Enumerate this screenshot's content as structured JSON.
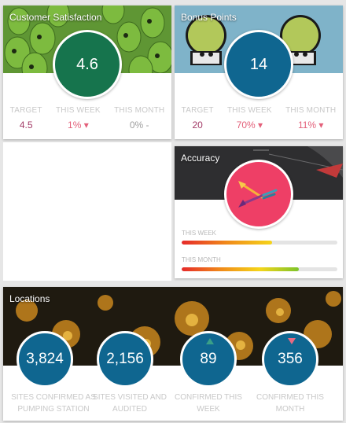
{
  "satisfaction": {
    "title": "Customer Satisfaction",
    "score": "4.6",
    "target_label": "TARGET",
    "target_value": "4.5",
    "week_label": "THIS WEEK",
    "week_value": "1% ▾",
    "month_label": "THIS MONTH",
    "month_value": "0% -",
    "circle_color": "#16744d"
  },
  "bonus": {
    "title": "Bonus Points",
    "score": "14",
    "target_label": "TARGET",
    "target_value": "20",
    "week_label": "THIS WEEK",
    "week_value": "70% ▾",
    "month_label": "THIS MONTH",
    "month_value": "11% ▾",
    "circle_color": "#0f6690"
  },
  "accuracy": {
    "title": "Accuracy",
    "week_label": "THIS WEEK",
    "week_level": 0.58,
    "month_label": "THIS MONTH",
    "month_level": 0.75,
    "circle_color": "#ee3f66"
  },
  "locations": {
    "title": "Locations",
    "items": [
      {
        "value": "3,824",
        "label": "SITES CONFIRMED AS PUMPING STATION"
      },
      {
        "value": "2,156",
        "label": "SITES VISITED AND AUDITED"
      },
      {
        "value": "89",
        "label": "CONFIRMED THIS WEEK",
        "trend": "up"
      },
      {
        "value": "356",
        "label": "CONFIRMED THIS MONTH",
        "trend": "down"
      }
    ]
  }
}
